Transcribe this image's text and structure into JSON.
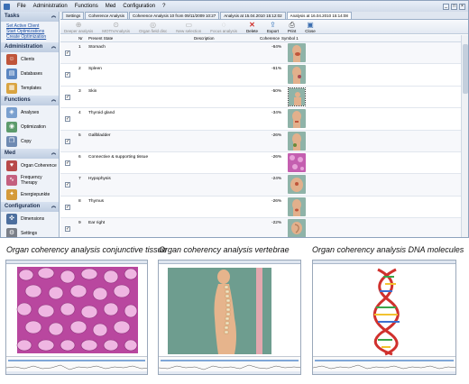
{
  "menubar": {
    "items": [
      "File",
      "Administration",
      "Functions",
      "Med",
      "Configuration",
      "?"
    ],
    "win_buttons": [
      "_",
      "□",
      "×"
    ]
  },
  "sidebar": {
    "tasks": {
      "title": "Tasks",
      "links": [
        "Set Active Client",
        "Start Optimizations",
        "Create Optimization"
      ]
    },
    "administration": {
      "title": "Administration",
      "items": [
        "Clients",
        "Databases",
        "Templates"
      ]
    },
    "functions": {
      "title": "Functions",
      "items": [
        "Analyses",
        "Optimization",
        "Copy"
      ]
    },
    "med": {
      "title": "Med",
      "items": [
        "Organ Coherence",
        "Frequency Therapy",
        "Energiepunkte"
      ]
    },
    "configuration": {
      "title": "Configuration",
      "items": [
        "Dimensions",
        "Settings"
      ]
    }
  },
  "tabs": [
    "Settings",
    "Coherence Analysis",
    "Coherence Analysis 10 from 09/11/2009 10:27",
    "Analysis at 15.04.2010 15:12:02",
    "Analysis at 16.04.2010 15:14:08"
  ],
  "toolbar": {
    "buttons": [
      {
        "label": "Deeper analysis",
        "icon": "deeper-analysis-icon"
      },
      {
        "label": "MOTIVAnalysis",
        "icon": "motiv-analysis-icon"
      },
      {
        "label": "Organ field disc",
        "icon": "organ-field-icon"
      },
      {
        "label": "New selection",
        "icon": "new-selection-icon"
      },
      {
        "label": "Focus analysis",
        "icon": "focus-analysis-icon"
      },
      {
        "label": "Delete",
        "icon": "delete-icon"
      },
      {
        "label": "Export",
        "icon": "export-icon"
      },
      {
        "label": "Print",
        "icon": "print-icon"
      },
      {
        "label": "Close",
        "icon": "close-icon"
      }
    ]
  },
  "grid": {
    "headers": {
      "nr": "Nr",
      "state": "Present State",
      "description": "Description",
      "coherence": "Coherence",
      "symbol": "Symbol 1"
    },
    "rows": [
      {
        "nr": "1",
        "state": "Stomach",
        "coherence": "-64%"
      },
      {
        "nr": "2",
        "state": "Spleen",
        "coherence": "-61%"
      },
      {
        "nr": "3",
        "state": "Skin",
        "coherence": "-50%"
      },
      {
        "nr": "4",
        "state": "Thyroid gland",
        "coherence": "-34%"
      },
      {
        "nr": "5",
        "state": "Gallbladder",
        "coherence": "-26%"
      },
      {
        "nr": "6",
        "state": "Connective & supporting tissue",
        "coherence": "-26%"
      },
      {
        "nr": "7",
        "state": "Hypophysis",
        "coherence": "-24%"
      },
      {
        "nr": "8",
        "state": "Thymus",
        "coherence": "-26%"
      },
      {
        "nr": "9",
        "state": "Ear right",
        "coherence": "-22%"
      }
    ]
  },
  "captions": {
    "c1": "Organ coherency analysis conjunctive tissue",
    "c2": "Organ coherency analysis vertebrae",
    "c3": "Organ coherency analysis DNA molecules"
  },
  "colors": {
    "accent": "#3a6fb5",
    "tissue": "#c45fb0",
    "spine_bg": "#6e9d8f"
  }
}
